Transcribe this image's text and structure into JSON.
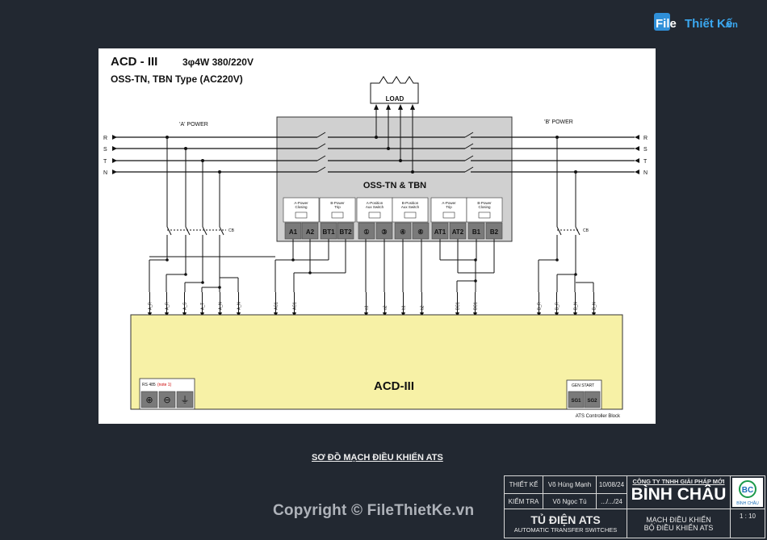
{
  "site_logo": {
    "text_file": "File",
    "text_thietke": "Thiết Kế",
    "text_vn": ".vn"
  },
  "diagram": {
    "title": "ACD - III",
    "spec": "3φ4W 380/220V",
    "subtitle": "OSS-TN, TBN Type (AC220V)",
    "load_label": "LOAD",
    "a_power_label": "'A' POWER",
    "b_power_label": "'B' POWER",
    "phases": [
      "R",
      "S",
      "T",
      "N"
    ],
    "switch_title": "OSS-TN & TBN",
    "cb_label": "CB",
    "switch_groups": [
      [
        "A-Power",
        "Closing"
      ],
      [
        "B-Power",
        "Trip"
      ],
      [
        "A-Position",
        "Aux Switch"
      ],
      [
        "B-Position",
        "Aux Switch"
      ],
      [
        "A-Power",
        "Trip"
      ],
      [
        "B-Power",
        "Closing"
      ]
    ],
    "switch_terminals": [
      "A1",
      "A2",
      "BT1",
      "BT2",
      "①",
      "③",
      "④",
      "⑥",
      "AT1",
      "AT2",
      "B1",
      "B2"
    ],
    "wire_labels": [
      "A_R",
      "A_R",
      "A_S",
      "A_T",
      "A_N",
      "A_N",
      "AC1",
      "AC1",
      "a1",
      "a2",
      "b1",
      "b2",
      "BC1",
      "BC1",
      "B_R",
      "B_R",
      "B_N",
      "B_N"
    ],
    "controller_terminals": [
      "A_R",
      "A_R",
      "A_S",
      "A_T",
      "A_N",
      "A_N",
      "AP1",
      "AP2",
      "a1",
      "a2",
      "b1",
      "b2",
      "BP1",
      "BP2",
      "B_R",
      "B_R",
      "B_N",
      "B_N"
    ],
    "group_labels": [
      [
        "A-Power",
        "Source"
      ],
      [
        "A-Power",
        "Operating Signal"
      ],
      [
        "A-Position",
        "AUX Contact"
      ],
      [
        "B-Position",
        "AUX Contact"
      ],
      [
        "B-Power",
        "Operating Signal"
      ],
      [
        "B-Power",
        "Source"
      ]
    ],
    "controller_name": "ACD-III",
    "rs485_label": "RS 485",
    "rs485_sub": "(note 1)",
    "rs485_terminals": [
      "⊕",
      "⊖",
      "⏚"
    ],
    "gen_start_label": "GEN START",
    "gen_terminals": [
      "SG1",
      "SG2"
    ],
    "controller_footer": "ATS Controller Block"
  },
  "caption": "SƠ ĐỒ MẠCH ĐIỀU KHIỂN ATS",
  "title_block": {
    "designer_label": "THIẾT KẾ",
    "designer_name": "Võ Hùng Mạnh",
    "designer_date": "10/08/24",
    "checker_label": "KIỂM TRA",
    "checker_name": "Võ Ngọc Tú",
    "checker_date": ".../.../24",
    "company_line1": "CÔNG TY TNHH GIẢI PHÁP MỚI",
    "company_line2": "BÌNH CHÂU",
    "company_logo_text": "BÌNH CHÂU",
    "project_title": "TỦ ĐIỆN ATS",
    "project_sub": "AUTOMATIC TRANSFER SWITCHES",
    "drawing_title1": "MẠCH ĐIỀU KHIỂN",
    "drawing_title2": "BỘ ĐIỀU KHIỂN ATS",
    "scale": "1 : 10"
  },
  "watermark": "Copyright © FileThietKe.vn",
  "colors": {
    "background": "#222831",
    "sheet": "#ffffff",
    "switch_box": "#d0d0d0",
    "controller": "#f7f1a6",
    "terminal": "#7a7a7a"
  }
}
